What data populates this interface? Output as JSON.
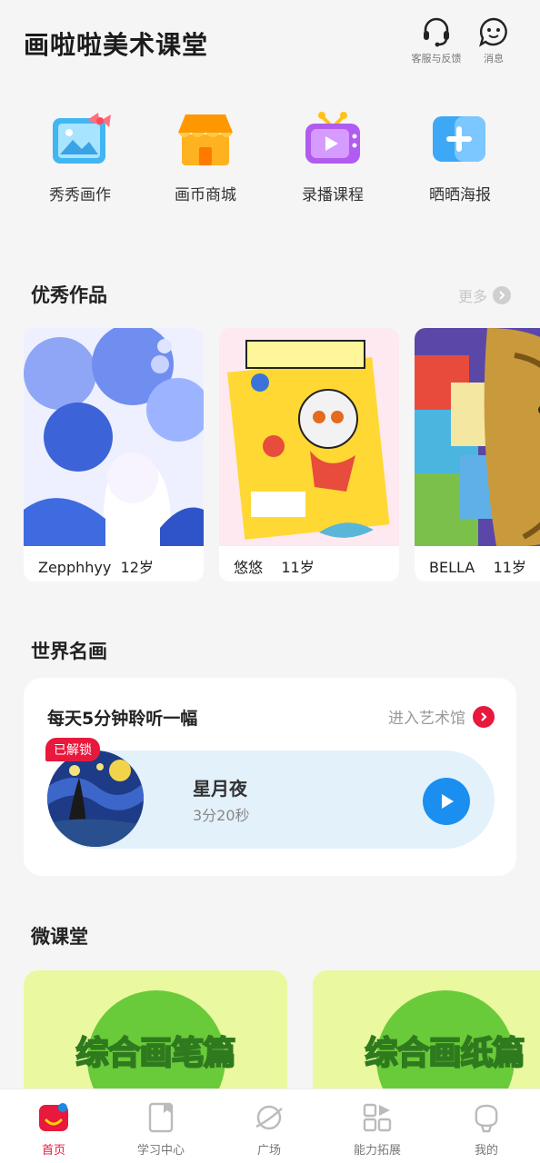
{
  "header": {
    "title": "画啦啦美术课堂",
    "support_label": "客服与反馈",
    "message_label": "消息"
  },
  "quick_actions": [
    {
      "label": "秀秀画作",
      "icon": "picture-frame-icon"
    },
    {
      "label": "画币商城",
      "icon": "shop-icon"
    },
    {
      "label": "录播课程",
      "icon": "tv-play-icon"
    },
    {
      "label": "晒晒海报",
      "icon": "add-poster-icon"
    }
  ],
  "excellent_works": {
    "title": "优秀作品",
    "more_label": "更多",
    "items": [
      {
        "label": "Zepphhyy  12岁"
      },
      {
        "label": "悠悠    11岁"
      },
      {
        "label": "BELLA    11岁"
      }
    ]
  },
  "world_paintings": {
    "title": "世界名画",
    "card_title": "每天5分钟聆听一幅",
    "enter_label": "进入艺术馆",
    "badge": "已解锁",
    "painting_title": "星月夜",
    "duration": "3分20秒"
  },
  "micro_class": {
    "title": "微课堂",
    "items": [
      {
        "label": "综合画笔篇"
      },
      {
        "label": "综合画纸篇"
      }
    ]
  },
  "tabbar": {
    "active_index": 0,
    "accent": "#e8193c",
    "items": [
      {
        "label": "首页",
        "icon": "home-icon"
      },
      {
        "label": "学习中心",
        "icon": "book-icon"
      },
      {
        "label": "广场",
        "icon": "planet-icon"
      },
      {
        "label": "能力拓展",
        "icon": "grid-icon"
      },
      {
        "label": "我的",
        "icon": "profile-icon"
      }
    ]
  }
}
